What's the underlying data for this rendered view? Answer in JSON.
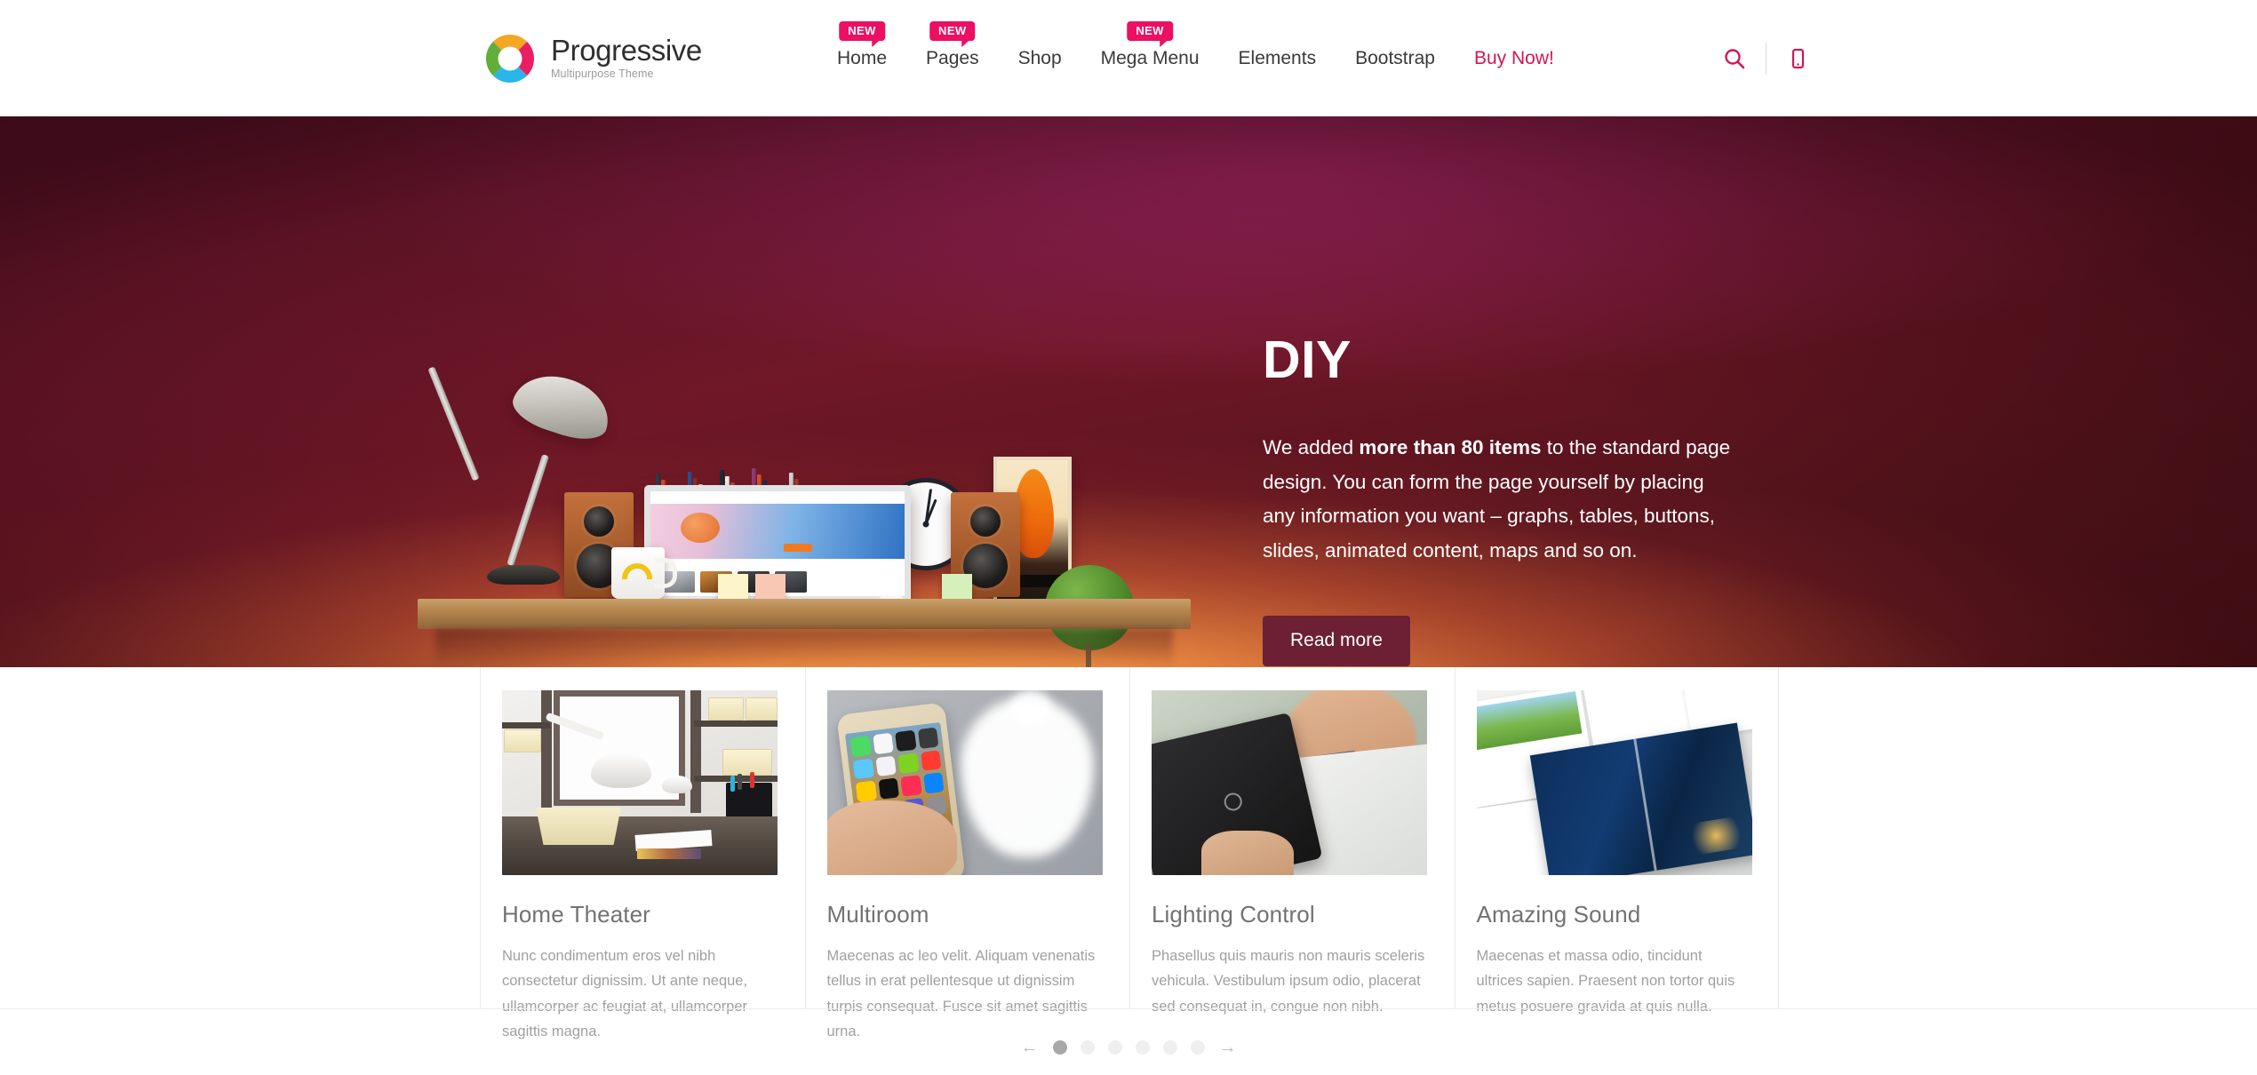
{
  "header": {
    "logo": {
      "title": "Progressive",
      "subtitle": "Multipurpose Theme",
      "icon": "ring-logo-icon",
      "colors": [
        "#f5a623",
        "#e91e63",
        "#29b6e8",
        "#63ad3a"
      ]
    },
    "nav": [
      {
        "label": "Home",
        "badge": "NEW",
        "highlight": false
      },
      {
        "label": "Pages",
        "badge": "NEW",
        "highlight": false
      },
      {
        "label": "Shop",
        "badge": "",
        "highlight": false
      },
      {
        "label": "Mega Menu",
        "badge": "NEW",
        "highlight": false
      },
      {
        "label": "Elements",
        "badge": "",
        "highlight": false
      },
      {
        "label": "Bootstrap",
        "badge": "",
        "highlight": false
      },
      {
        "label": "Buy Now!",
        "badge": "",
        "highlight": true
      }
    ],
    "icons": {
      "search": "search-icon",
      "mobile": "mobile-phone-icon"
    },
    "accent_color": "#ec0f63",
    "buy_now_color": "#cf1757"
  },
  "hero": {
    "title": "DIY",
    "paragraph_before": "We added ",
    "paragraph_bold": "more than 80 items",
    "paragraph_after": " to the standard page design. You can form the page yourself by placing any information you want – graphs, tables, buttons, slides, animated content, maps and so on.",
    "button_label": "Read more",
    "button_color": "#6d2034",
    "image_alt": "desk-shelf-workspace-scene"
  },
  "cards": [
    {
      "title": "Home Theater",
      "desc": "Nunc condimentum eros vel nibh consectetur dignissim. Ut ante neque, ullamcorper ac feugiat at, ullamcorper sagittis magna.",
      "image_alt": "white-office-shelf-lamp-photo"
    },
    {
      "title": "Multiroom",
      "desc": "Maecenas ac leo velit. Aliquam venenatis tellus in erat pellentesque ut dignissim turpis consequat. Fusce sit amet sagittis urna.",
      "image_alt": "hand-holding-gold-iphone-photo"
    },
    {
      "title": "Lighting Control",
      "desc": "Phasellus quis mauris non mauris sceleris vehicula. Vestibulum ipsum odio, placerat sed consequat in, congue non nibh.",
      "image_alt": "man-holding-black-tablet-photo"
    },
    {
      "title": "Amazing Sound",
      "desc": "Maecenas et massa odio, tincidunt ultrices sapien. Praesent non tortor quis metus posuere gravida at quis nulla.",
      "image_alt": "philips-brochures-spread-photo"
    }
  ],
  "pagination": {
    "prev_icon": "arrow-left-icon",
    "next_icon": "arrow-right-icon",
    "dot_count": 6,
    "active_index": 0
  }
}
